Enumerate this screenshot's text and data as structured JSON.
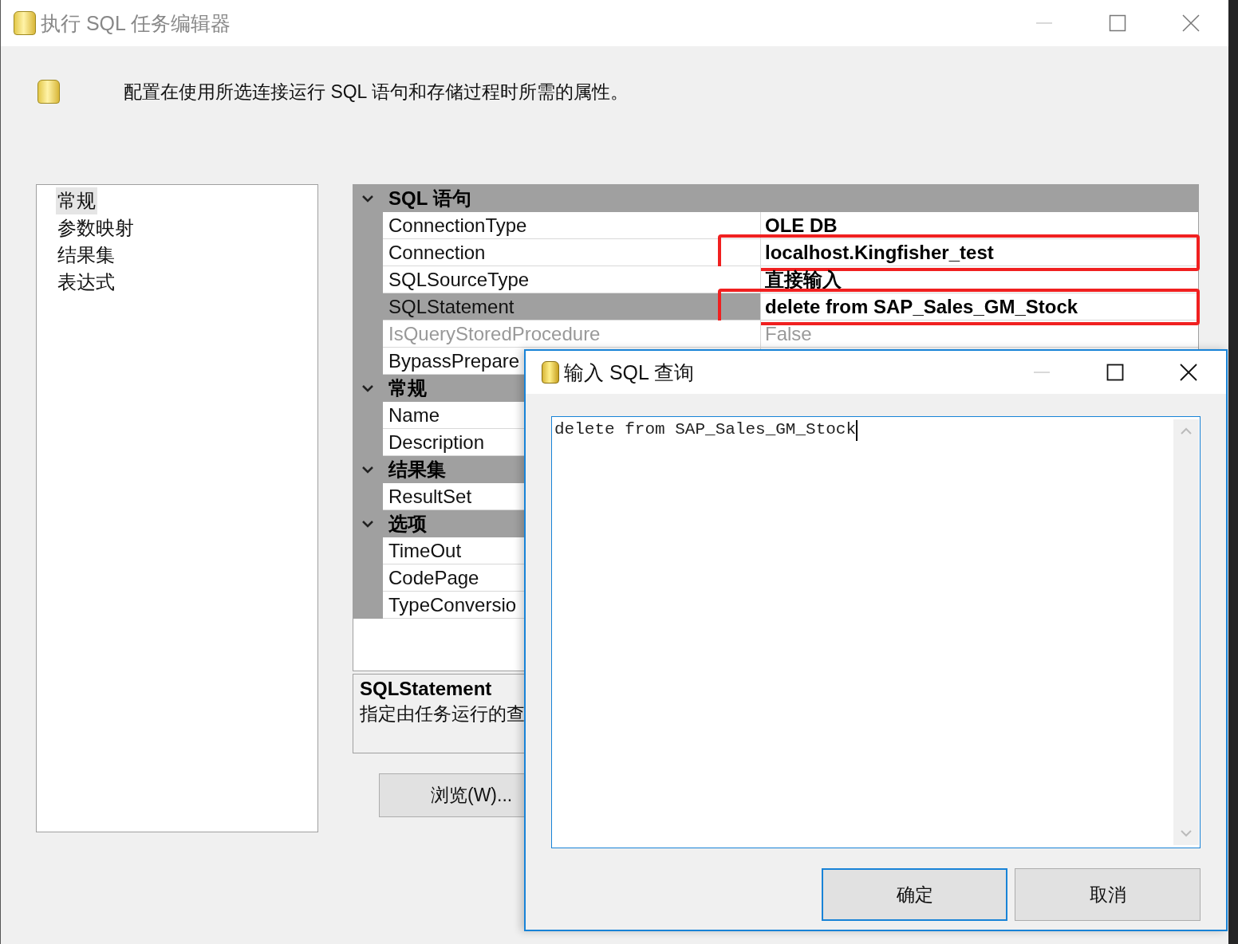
{
  "window": {
    "title": "执行 SQL 任务编辑器"
  },
  "header": {
    "description": "配置在使用所选连接运行 SQL 语句和存储过程时所需的属性。"
  },
  "nav": {
    "items": [
      {
        "label": "常规",
        "selected": true
      },
      {
        "label": "参数映射",
        "selected": false
      },
      {
        "label": "结果集",
        "selected": false
      },
      {
        "label": "表达式",
        "selected": false
      }
    ]
  },
  "properties": {
    "categories": [
      {
        "title": "SQL 语句",
        "expanded": true,
        "rows": [
          {
            "name": "ConnectionType",
            "value": "OLE DB",
            "selected": false,
            "disabled": false,
            "highlighted": false
          },
          {
            "name": "Connection",
            "value": "localhost.Kingfisher_test",
            "selected": false,
            "disabled": false,
            "highlighted": true
          },
          {
            "name": "SQLSourceType",
            "value": "直接输入",
            "selected": false,
            "disabled": false,
            "highlighted": false
          },
          {
            "name": "SQLStatement",
            "value": "delete from SAP_Sales_GM_Stock",
            "selected": true,
            "disabled": false,
            "highlighted": true
          },
          {
            "name": "IsQueryStoredProcedure",
            "value": "False",
            "selected": false,
            "disabled": true,
            "highlighted": false
          },
          {
            "name": "BypassPrepare",
            "selected": false,
            "disabled": false
          }
        ]
      },
      {
        "title": "常规",
        "expanded": true,
        "rows": [
          {
            "name": "Name",
            "selected": false,
            "disabled": false
          },
          {
            "name": "Description",
            "selected": false,
            "disabled": false
          }
        ]
      },
      {
        "title": "结果集",
        "expanded": true,
        "rows": [
          {
            "name": "ResultSet",
            "selected": false,
            "disabled": false
          }
        ]
      },
      {
        "title": "选项",
        "expanded": true,
        "rows": [
          {
            "name": "TimeOut",
            "selected": false,
            "disabled": false
          },
          {
            "name": "CodePage",
            "selected": false,
            "disabled": false
          },
          {
            "name": "TypeConversio",
            "selected": false,
            "disabled": false
          }
        ]
      }
    ]
  },
  "description_panel": {
    "title": "SQLStatement",
    "text": "指定由任务运行的查"
  },
  "browse_button": {
    "label": "浏览(W)..."
  },
  "dialog": {
    "title": "输入 SQL 查询",
    "query": "delete from SAP_Sales_GM_Stock",
    "buttons": [
      {
        "label": "确定",
        "default": true
      },
      {
        "label": "取消",
        "default": false
      }
    ]
  }
}
